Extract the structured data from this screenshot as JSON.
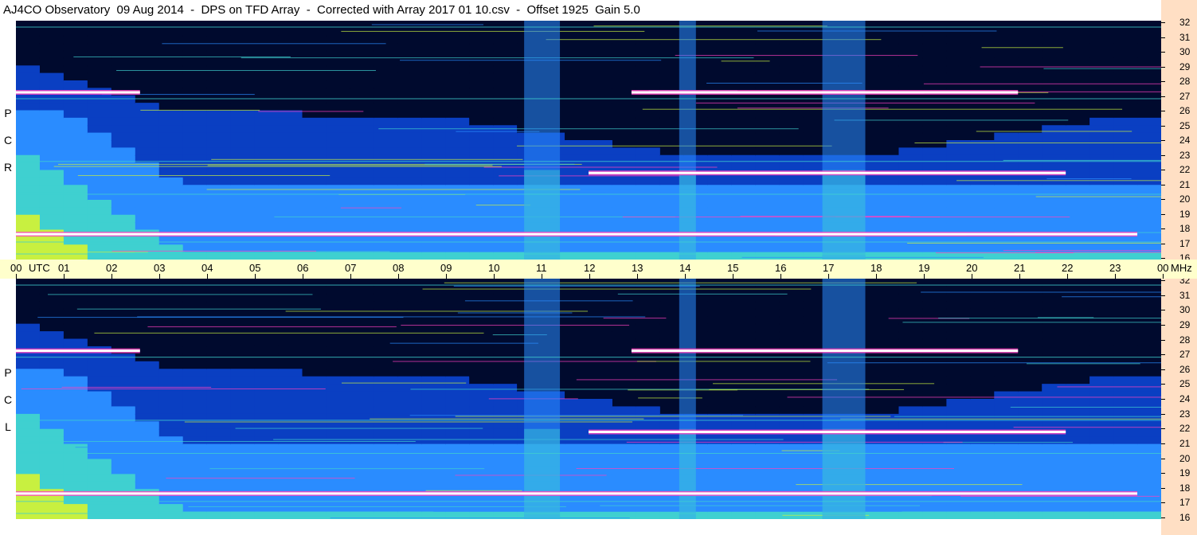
{
  "title": "AJ4CO Observatory  09 Aug 2014  -  DPS on TFD Array  -  Corrected with Array 2017 01 10.csv  -  Offset 1925  Gain 5.0",
  "panels": [
    {
      "polarization": [
        "R",
        "C",
        "P"
      ]
    },
    {
      "polarization": [
        "L",
        "C",
        "P"
      ]
    }
  ],
  "time_axis": {
    "labels": [
      "00",
      "UTC",
      "01",
      "02",
      "03",
      "04",
      "05",
      "06",
      "07",
      "08",
      "09",
      "10",
      "11",
      "12",
      "13",
      "14",
      "15",
      "16",
      "17",
      "18",
      "19",
      "20",
      "21",
      "22",
      "23",
      "00"
    ],
    "unit_right": "MHz"
  },
  "freq_axis": {
    "ticks": [
      "32",
      "31",
      "30",
      "29",
      "28",
      "27",
      "26",
      "25",
      "24",
      "23",
      "22",
      "21",
      "20",
      "19",
      "18",
      "17",
      "16"
    ]
  },
  "chart_data": {
    "type": "heatmap",
    "x_label": "UTC",
    "y_label": "MHz",
    "x_range_hours": [
      0,
      24
    ],
    "y_range_mhz": [
      16,
      32
    ],
    "colors": {
      "low": "#000a2e",
      "mid_low": "#0a3fc2",
      "mid": "#2a8cff",
      "high": "#3fd0d0",
      "very_high": "#c8f040",
      "saturated": "#ffffff",
      "interference": "#ff40c0"
    },
    "features": [
      {
        "desc": "broadband vertical band",
        "start_utc": 10.65,
        "end_utc": 11.4
      },
      {
        "desc": "broadband vertical band",
        "start_utc": 13.9,
        "end_utc": 14.25
      },
      {
        "desc": "vertical band cluster",
        "start_utc": 16.9,
        "end_utc": 17.8
      },
      {
        "desc": "strong emission line",
        "freq_mhz": 27.2,
        "start_utc": 0.0,
        "end_utc": 2.6
      },
      {
        "desc": "strong emission line",
        "freq_mhz": 27.2,
        "start_utc": 12.9,
        "end_utc": 21.0
      },
      {
        "desc": "strong emission line",
        "freq_mhz": 17.7,
        "start_utc": 0.0,
        "end_utc": 23.5
      },
      {
        "desc": "line",
        "freq_mhz": 21.8,
        "start_utc": 12.0,
        "end_utc": 22.0
      }
    ]
  }
}
